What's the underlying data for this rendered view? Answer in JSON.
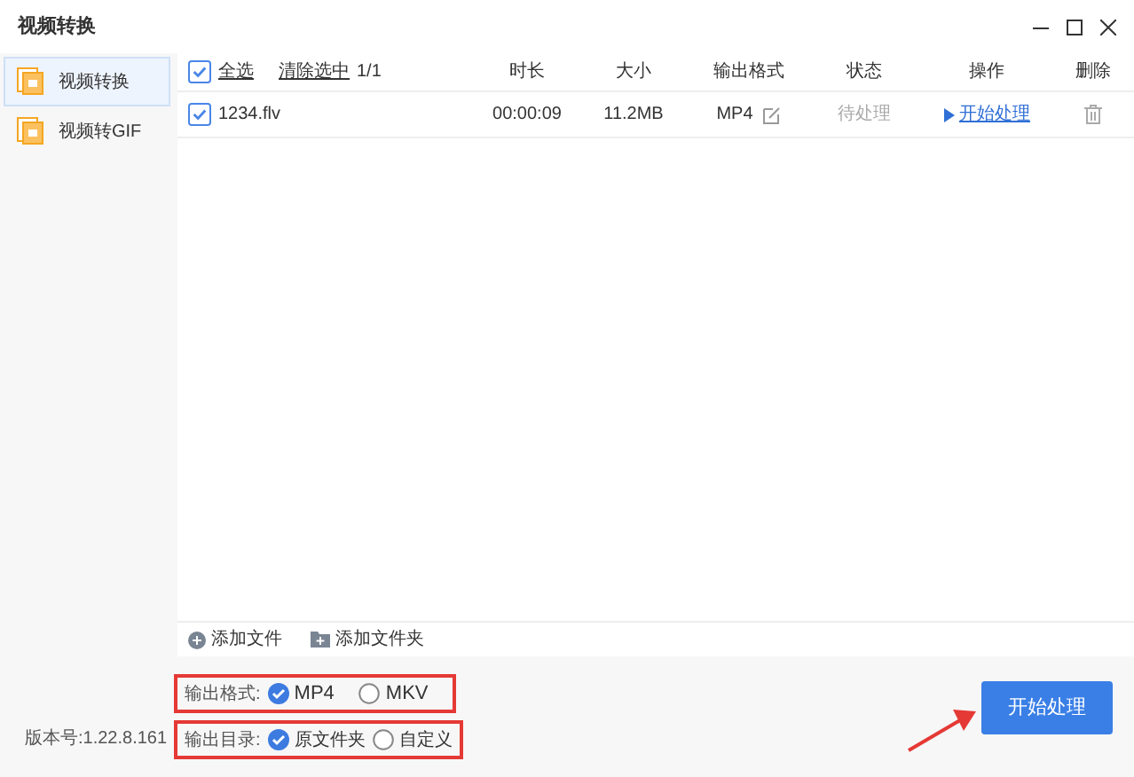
{
  "window": {
    "title": "视频转换"
  },
  "sidebar": {
    "items": [
      {
        "label": "视频转换",
        "selected": true
      },
      {
        "label": "视频转GIF",
        "selected": false
      }
    ],
    "version": "版本号:1.22.8.161"
  },
  "table": {
    "select_all": {
      "label": "全选",
      "checked": true
    },
    "clear_selection": "清除选中",
    "selection_count": "1/1",
    "columns": [
      "时长",
      "大小",
      "输出格式",
      "状态",
      "操作",
      "删除"
    ],
    "rows": [
      {
        "checked": true,
        "name": "1234.flv",
        "duration": "00:00:09",
        "size": "11.2MB",
        "format": "MP4",
        "status": "待处理",
        "action": "开始处理"
      }
    ]
  },
  "add_buttons": [
    {
      "kind": "file",
      "label": "添加文件"
    },
    {
      "kind": "folder",
      "label": "添加文件夹"
    }
  ],
  "options": [
    {
      "label": "输出格式:",
      "choices": [
        {
          "label": "MP4",
          "selected": true
        },
        {
          "label": "MKV",
          "selected": false
        }
      ]
    },
    {
      "label": "输出目录:",
      "choices": [
        {
          "label": "原文件夹",
          "selected": true
        },
        {
          "label": "自定义",
          "selected": false
        }
      ]
    }
  ],
  "start_button": "开始处理"
}
